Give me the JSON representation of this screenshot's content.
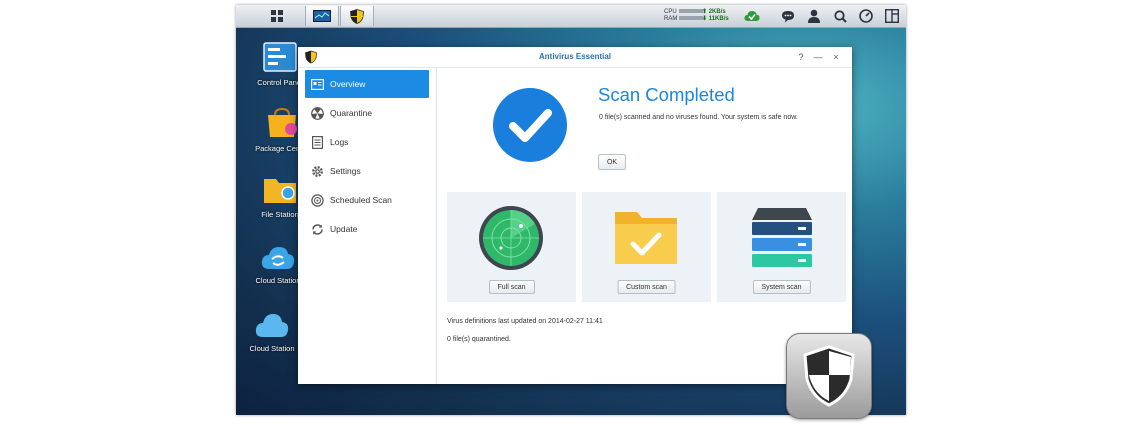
{
  "taskbar": {
    "cpu_label": "CPU",
    "ram_label": "RAM",
    "upload_speed": "2KB/s",
    "download_speed": "11KB/s"
  },
  "desktop": {
    "icons": [
      {
        "label": "Control Panel",
        "icon": "control-panel-icon"
      },
      {
        "label": "Package Center",
        "icon": "package-center-icon"
      },
      {
        "label": "File Station",
        "icon": "file-station-icon"
      },
      {
        "label": "Cloud Station",
        "icon": "cloud-station-icon"
      },
      {
        "label": "Cloud Station",
        "icon": "cloud-station-icon"
      }
    ]
  },
  "window": {
    "title": "Antivirus Essential",
    "help": "?",
    "minimize": "—",
    "close": "×"
  },
  "sidebar": {
    "items": [
      {
        "label": "Overview",
        "icon": "overview-icon",
        "active": true
      },
      {
        "label": "Quarantine",
        "icon": "quarantine-icon"
      },
      {
        "label": "Logs",
        "icon": "logs-icon"
      },
      {
        "label": "Settings",
        "icon": "gear-icon"
      },
      {
        "label": "Scheduled Scan",
        "icon": "scheduled-scan-icon"
      },
      {
        "label": "Update",
        "icon": "update-icon"
      }
    ]
  },
  "main": {
    "status_title": "Scan Completed",
    "status_desc": "0 file(s) scanned and no viruses found. Your system is safe now.",
    "ok_label": "OK",
    "cards": [
      {
        "label": "Full scan",
        "icon": "radar-icon"
      },
      {
        "label": "Custom scan",
        "icon": "folder-check-icon"
      },
      {
        "label": "System scan",
        "icon": "server-icon"
      }
    ],
    "definitions_text": "Virus definitions last updated on 2014-02-27 11:41",
    "quarantined_text": "0 file(s) quarantined."
  },
  "colors": {
    "accent": "#1b8be3",
    "title_blue": "#1a86de",
    "success_circle": "#1a7fdc"
  }
}
